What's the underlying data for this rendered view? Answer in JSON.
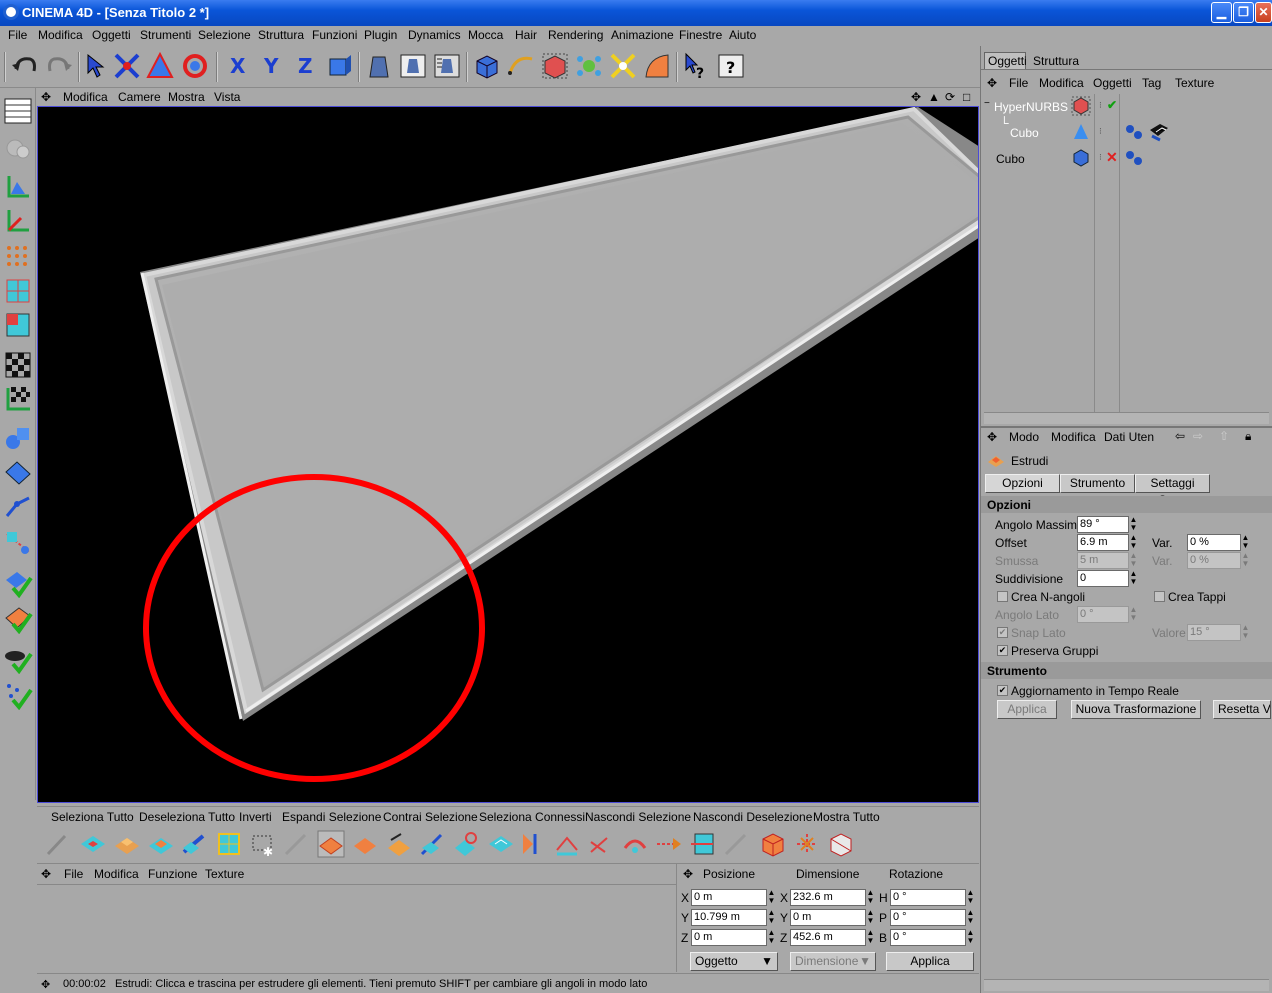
{
  "window": {
    "title": "CINEMA 4D - [Senza Titolo 2 *]"
  },
  "menubar": [
    "File",
    "Modifica",
    "Oggetti",
    "Strumenti",
    "Selezione",
    "Struttura",
    "Funzioni",
    "Plugin",
    "Dynamics",
    "Mocca",
    "Hair",
    "Rendering",
    "Animazione",
    "Finestre",
    "Aiuto"
  ],
  "viewport": {
    "menu": [
      "Modifica",
      "Camere",
      "Mostra",
      "Vista"
    ]
  },
  "selection_bar": [
    "Seleziona Tutto",
    "Deseleziona Tutto",
    "Inverti",
    "Espandi Selezione",
    "Contrai Selezione",
    "Seleziona Connessi",
    "Nascondi Selezione",
    "Nascondi Deselezione",
    "Mostra Tutto"
  ],
  "material_manager": {
    "menu": [
      "File",
      "Modifica",
      "Funzione",
      "Texture"
    ]
  },
  "coords": {
    "headers": [
      "Posizione",
      "Dimensione",
      "Rotazione"
    ],
    "rows": [
      {
        "axis_pos": "X",
        "pos": "0 m",
        "axis_dim": "X",
        "dim": "232.6 m",
        "axis_rot": "H",
        "rot": "0 °"
      },
      {
        "axis_pos": "Y",
        "pos": "10.799 m",
        "axis_dim": "Y",
        "dim": "0 m",
        "axis_rot": "P",
        "rot": "0 °"
      },
      {
        "axis_pos": "Z",
        "pos": "0 m",
        "axis_dim": "Z",
        "dim": "452.6 m",
        "axis_rot": "B",
        "rot": "0 °"
      }
    ],
    "mode_select": "Oggetto",
    "dim_select": "Dimensione",
    "apply": "Applica"
  },
  "status": {
    "time": "00:00:02",
    "message": "Estrudi: Clicca e trascina per estrudere gli elementi. Tieni premuto SHIFT per cambiare gli angoli in modo lato"
  },
  "object_manager": {
    "tabs": [
      "Oggetti",
      "Struttura"
    ],
    "menu": [
      "File",
      "Modifica",
      "Oggetti",
      "Tag",
      "Texture"
    ],
    "objects": [
      {
        "name": "HyperNURBS",
        "minus": "−"
      },
      {
        "name": "Cubo"
      },
      {
        "name": "Cubo"
      }
    ]
  },
  "attributes": {
    "menu": [
      "Modo",
      "Modifica",
      "Dati Uten"
    ],
    "tool_name": "Estrudi",
    "tabs": [
      "Opzioni",
      "Strumento",
      "Settaggi Snap"
    ],
    "section_options": "Opzioni",
    "angolo_massimo": {
      "label": "Angolo Massimo",
      "value": "89 °"
    },
    "offset": {
      "label": "Offset",
      "value": "6.9 m",
      "var_label": "Var.",
      "var_value": "0 %"
    },
    "smussa": {
      "label": "Smussa",
      "value": "5 m",
      "var_label": "Var.",
      "var_value": "0 %"
    },
    "suddivisione": {
      "label": "Suddivisione",
      "value": "0"
    },
    "crea_nangoli": {
      "label": "Crea N-angoli",
      "checked": false
    },
    "crea_tappi": {
      "label": "Crea Tappi",
      "checked": false
    },
    "angolo_lato": {
      "label": "Angolo Lato",
      "value": "0 °"
    },
    "snap_lato": {
      "label": "Snap Lato",
      "checked": true,
      "valore_label": "Valore",
      "valore": "15 °"
    },
    "preserva_gruppi": {
      "label": "Preserva Gruppi",
      "checked": true
    },
    "section_tool": "Strumento",
    "realtime": {
      "label": "Aggiornamento in Tempo Reale",
      "checked": true
    },
    "buttons": {
      "apply": "Applica",
      "new_transform": "Nuova Trasformazione",
      "reset": "Resetta V"
    }
  },
  "colors": {
    "accent_circle": "#ff0000",
    "viewport_border": "#4b4bd6",
    "titlebar": "#0a55d8"
  }
}
